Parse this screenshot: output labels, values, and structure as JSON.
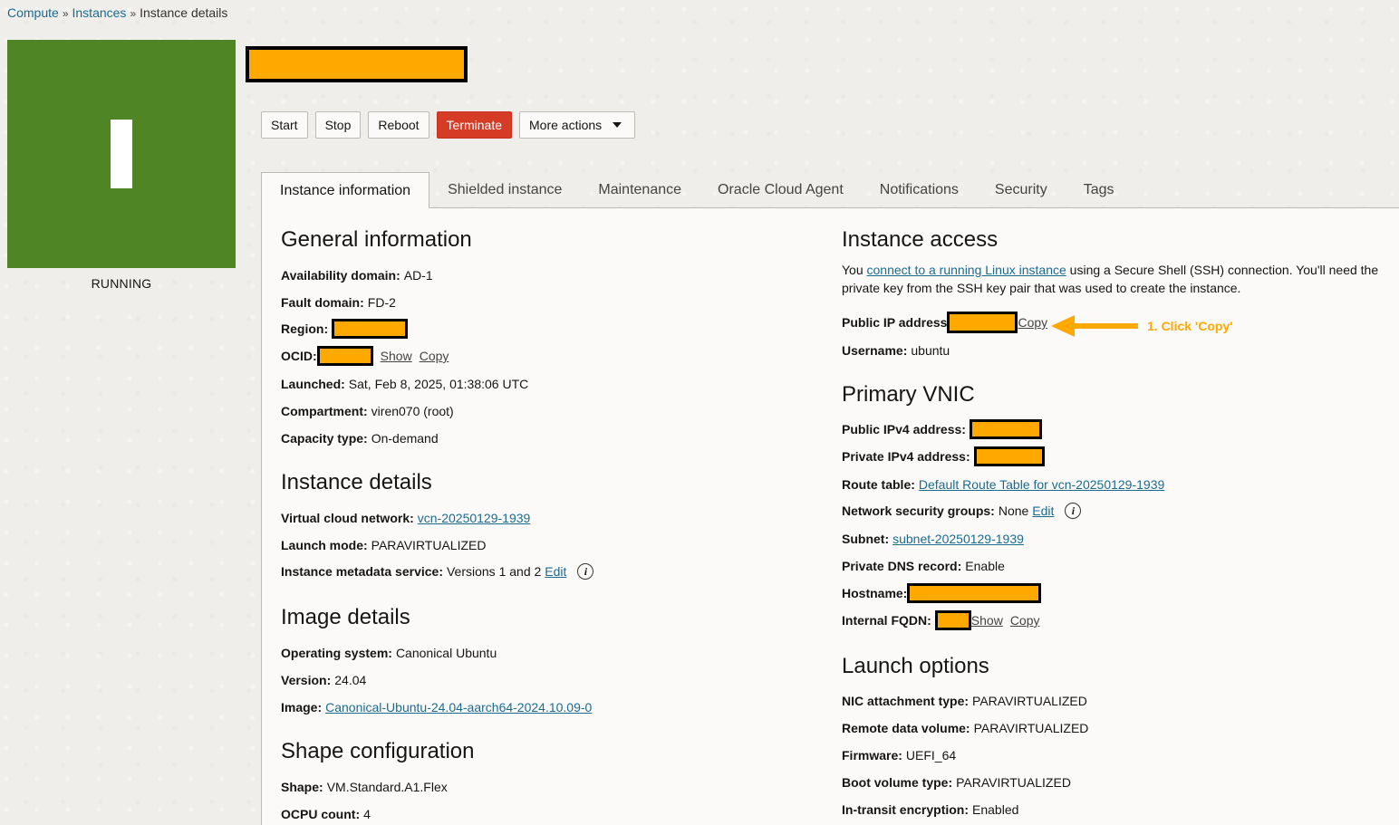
{
  "breadcrumb": {
    "items": [
      "Compute",
      "Instances"
    ],
    "sep": "»",
    "current": "Instance details"
  },
  "status": {
    "label": "RUNNING",
    "color": "#4f8524"
  },
  "actions": {
    "start": "Start",
    "stop": "Stop",
    "reboot": "Reboot",
    "terminate": "Terminate",
    "more": "More actions"
  },
  "tabs": [
    "Instance information",
    "Shielded instance",
    "Maintenance",
    "Oracle Cloud Agent",
    "Notifications",
    "Security",
    "Tags"
  ],
  "general": {
    "title": "General information",
    "availability_domain_label": "Availability domain:",
    "availability_domain": "AD-1",
    "fault_domain_label": "Fault domain:",
    "fault_domain": "FD-2",
    "region_label": "Region:",
    "ocid_label": "OCID:",
    "show": "Show",
    "copy": "Copy",
    "launched_label": "Launched:",
    "launched": "Sat, Feb 8, 2025, 01:38:06 UTC",
    "compartment_label": "Compartment:",
    "compartment": "viren070 (root)",
    "capacity_label": "Capacity type:",
    "capacity": "On-demand"
  },
  "instance_details": {
    "title": "Instance details",
    "vcn_label": "Virtual cloud network:",
    "vcn": "vcn-20250129-1939",
    "launch_mode_label": "Launch mode:",
    "launch_mode": "PARAVIRTUALIZED",
    "metadata_label": "Instance metadata service:",
    "metadata": "Versions 1 and 2",
    "edit": "Edit"
  },
  "image": {
    "title": "Image details",
    "os_label": "Operating system:",
    "os": "Canonical Ubuntu",
    "version_label": "Version:",
    "version": "24.04",
    "image_label": "Image:",
    "image": "Canonical-Ubuntu-24.04-aarch64-2024.10.09-0"
  },
  "shape": {
    "title": "Shape configuration",
    "shape_label": "Shape:",
    "shape": "VM.Standard.A1.Flex",
    "ocpu_label": "OCPU count:",
    "ocpu": "4"
  },
  "access": {
    "title": "Instance access",
    "text_before": "You ",
    "link": "connect to a running Linux instance",
    "text_after": " using a Secure Shell (SSH) connection. You'll need the private key from the SSH key pair that was used to create the instance.",
    "public_ip_label": "Public IP address",
    "copy": "Copy",
    "username_label": "Username:",
    "username": "ubuntu"
  },
  "annotation": {
    "text": "1. Click 'Copy'",
    "color": "#ffa800"
  },
  "vnic": {
    "title": "Primary VNIC",
    "public_ipv4_label": "Public IPv4 address:",
    "private_ipv4_label": "Private IPv4 address:",
    "route_table_label": "Route table:",
    "route_table": "Default Route Table for vcn-20250129-1939",
    "nsg_label": "Network security groups:",
    "nsg": "None",
    "edit": "Edit",
    "subnet_label": "Subnet:",
    "subnet": "subnet-20250129-1939",
    "dns_label": "Private DNS record:",
    "dns": "Enable",
    "hostname_label": "Hostname:",
    "fqdn_label": "Internal FQDN:",
    "show": "Show",
    "copy": "Copy"
  },
  "launch": {
    "title": "Launch options",
    "nic_label": "NIC attachment type:",
    "nic": "PARAVIRTUALIZED",
    "remote_label": "Remote data volume:",
    "remote": "PARAVIRTUALIZED",
    "firmware_label": "Firmware:",
    "firmware": "UEFI_64",
    "boot_label": "Boot volume type:",
    "boot": "PARAVIRTUALIZED",
    "transit_label": "In-transit encryption:",
    "transit": "Enabled"
  }
}
